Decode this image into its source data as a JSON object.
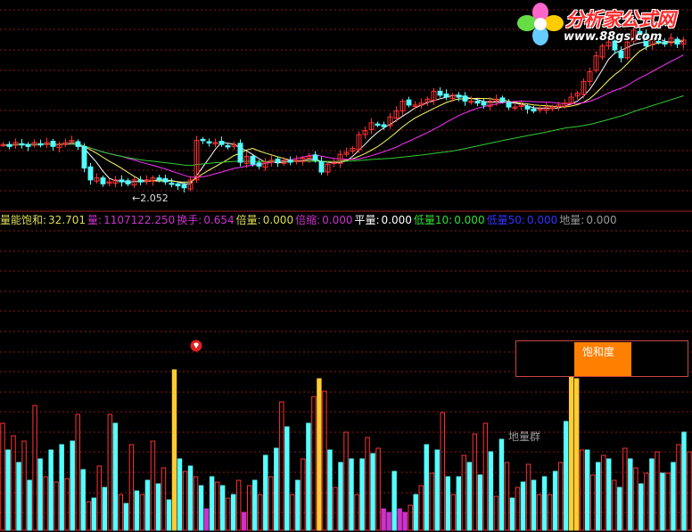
{
  "logo": {
    "title": "分析家公式网",
    "url": "www.88gs.com"
  },
  "status": {
    "items": [
      {
        "label": "量能饱和:",
        "value": "32.701",
        "color": "#dddd55"
      },
      {
        "label": "量:",
        "value": "1107122.250",
        "color": "#cc33cc"
      },
      {
        "label": "换手:",
        "value": "0.654",
        "color": "#cc33cc"
      },
      {
        "label": "倍量:",
        "value": "0.000",
        "color": "#dddd55"
      },
      {
        "label": "倍缩:",
        "value": "0.000",
        "color": "#cc33cc"
      },
      {
        "label": "平量:",
        "value": "0.000",
        "color": "#ffffff"
      },
      {
        "label": "低量10:",
        "value": "0.000",
        "color": "#33dd33"
      },
      {
        "label": "低量50:",
        "value": "0.000",
        "color": "#3333ff"
      },
      {
        "label": "地量:",
        "value": "0.000",
        "color": "#999999"
      }
    ]
  },
  "price_note": "←2.052",
  "legend_label": "饱和度",
  "group_label": "地量群",
  "colors": {
    "up": "#ff3232",
    "down": "#54ffff",
    "ma5": "#ffffff",
    "ma10": "#ffff64",
    "ma20": "#ff32ff",
    "ma60": "#32cd32",
    "grid": "#8b1a1a",
    "double": "#ffcc33",
    "shrink": "#cc33cc",
    "low10": "#33dd33",
    "low50": "#3333ff",
    "flat": "#ffffff"
  },
  "chart_data": [
    {
      "type": "candlestick",
      "title": "",
      "annotations": [
        "←2.052"
      ],
      "close": [
        2.28,
        2.27,
        2.29,
        2.28,
        2.27,
        2.29,
        2.28,
        2.29,
        2.27,
        2.28,
        2.29,
        2.3,
        2.27,
        2.16,
        2.1,
        2.11,
        2.08,
        2.09,
        2.1,
        2.09,
        2.08,
        2.1,
        2.09,
        2.1,
        2.11,
        2.1,
        2.09,
        2.08,
        2.07,
        2.06,
        2.1,
        2.3,
        2.3,
        2.29,
        2.29,
        2.28,
        2.27,
        2.28,
        2.19,
        2.22,
        2.18,
        2.17,
        2.19,
        2.2,
        2.19,
        2.2,
        2.19,
        2.2,
        2.21,
        2.22,
        2.2,
        2.14,
        2.18,
        2.19,
        2.23,
        2.24,
        2.26,
        2.33,
        2.35,
        2.39,
        2.38,
        2.37,
        2.42,
        2.45,
        2.5,
        2.48,
        2.48,
        2.49,
        2.51,
        2.55,
        2.53,
        2.52,
        2.53,
        2.52,
        2.5,
        2.5,
        2.49,
        2.48,
        2.5,
        2.51,
        2.5,
        2.47,
        2.47,
        2.48,
        2.46,
        2.45,
        2.46,
        2.47,
        2.47,
        2.48,
        2.49,
        2.52,
        2.54,
        2.6,
        2.65,
        2.73,
        2.78,
        2.8,
        2.76,
        2.72,
        2.8,
        2.86,
        2.84,
        2.78,
        2.81,
        2.8,
        2.79,
        2.82,
        2.79,
        2.81
      ]
    },
    {
      "type": "bar",
      "title": "",
      "values": [
        60,
        45,
        53,
        38,
        50,
        28,
        70,
        40,
        30,
        45,
        27,
        48,
        29,
        50,
        65,
        34,
        16,
        18,
        36,
        24,
        65,
        60,
        20,
        15,
        48,
        22,
        20,
        28,
        50,
        26,
        35,
        17,
        90,
        40,
        33,
        36,
        30,
        25,
        12,
        30,
        27,
        25,
        18,
        20,
        28,
        10,
        25,
        28,
        20,
        42,
        30,
        46,
        72,
        58,
        20,
        28,
        40,
        60,
        75,
        85,
        78,
        45,
        24,
        38,
        55,
        40,
        20,
        40,
        52,
        43,
        46,
        12,
        10,
        33,
        12,
        10,
        14,
        20,
        25,
        48,
        32,
        45,
        66,
        30,
        20,
        30,
        42,
        38,
        54,
        31,
        60,
        44,
        19,
        51,
        38,
        18,
        24,
        27,
        37,
        28,
        20,
        30,
        20,
        33,
        38,
        61,
        90,
        85,
        45,
        45,
        31,
        38,
        42,
        40,
        28,
        24,
        46,
        40,
        35,
        26,
        32,
        40,
        44,
        32,
        32,
        38,
        48,
        55,
        44
      ]
    }
  ]
}
